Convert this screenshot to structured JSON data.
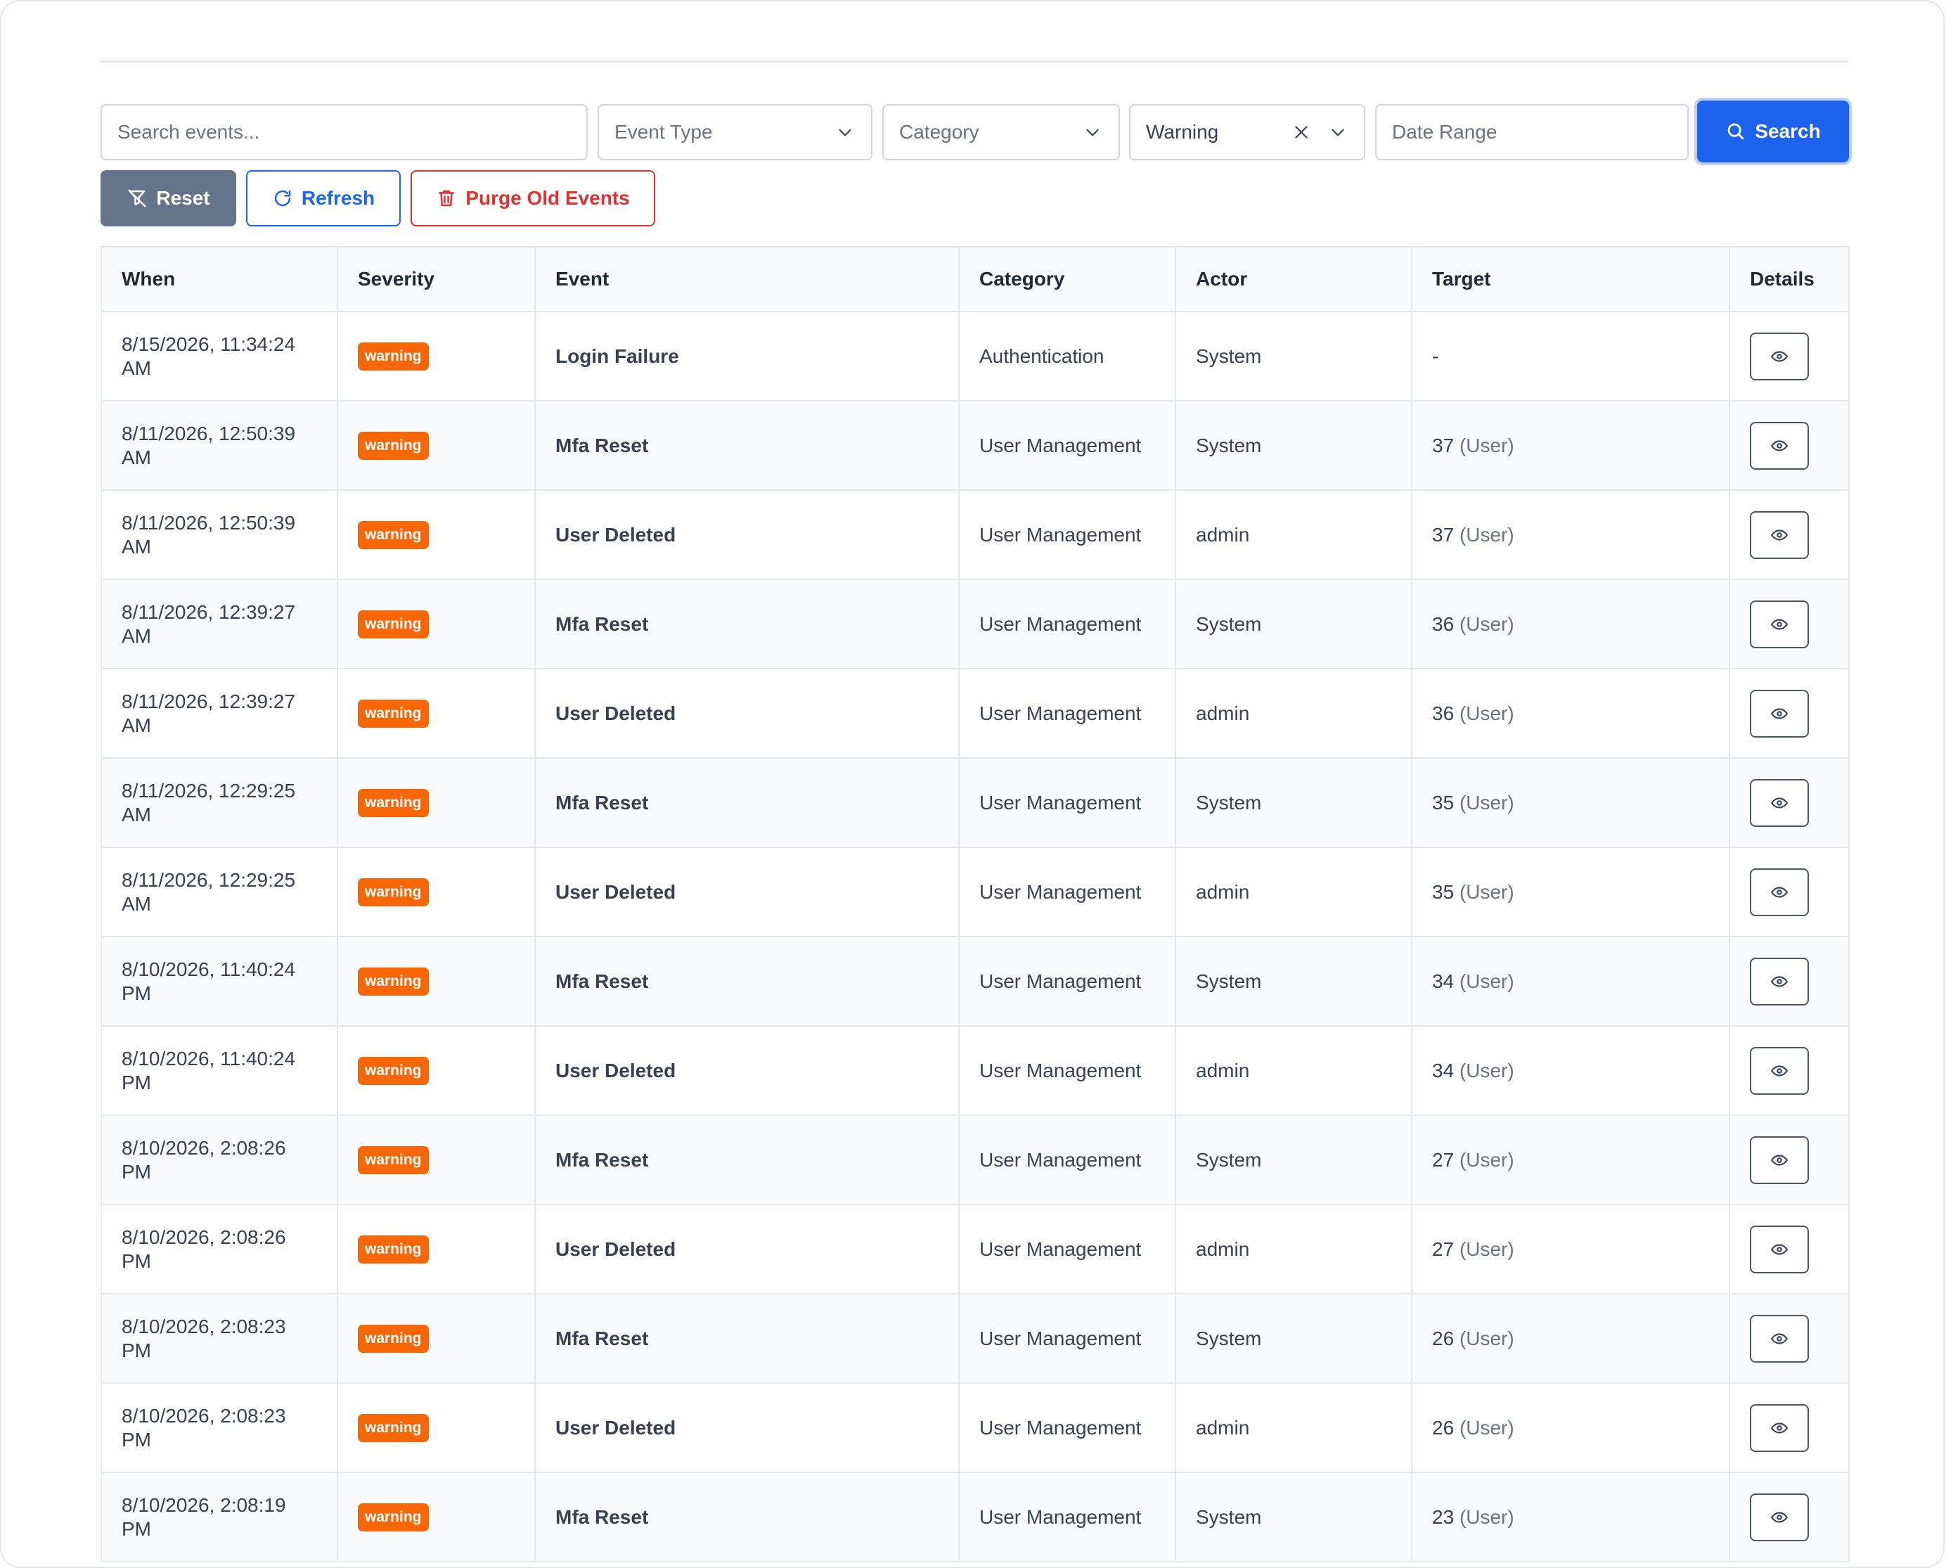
{
  "filters": {
    "search_placeholder": "Search events...",
    "event_type_placeholder": "Event Type",
    "category_placeholder": "Category",
    "severity_selected": "Warning",
    "date_range_placeholder": "Date Range",
    "search_label": "Search"
  },
  "actions": {
    "reset_label": "Reset",
    "refresh_label": "Refresh",
    "purge_label": "Purge Old Events"
  },
  "table": {
    "headers": {
      "when": "When",
      "severity": "Severity",
      "event": "Event",
      "category": "Category",
      "actor": "Actor",
      "target": "Target",
      "details": "Details"
    },
    "rows": [
      {
        "when": "8/15/2026, 11:34:24 AM",
        "severity": "warning",
        "event": "Login Failure",
        "category": "Authentication",
        "actor": "System",
        "target_id": "-",
        "target_type": ""
      },
      {
        "when": "8/11/2026, 12:50:39 AM",
        "severity": "warning",
        "event": "Mfa Reset",
        "category": "User Management",
        "actor": "System",
        "target_id": "37",
        "target_type": "(User)"
      },
      {
        "when": "8/11/2026, 12:50:39 AM",
        "severity": "warning",
        "event": "User Deleted",
        "category": "User Management",
        "actor": "admin",
        "target_id": "37",
        "target_type": "(User)"
      },
      {
        "when": "8/11/2026, 12:39:27 AM",
        "severity": "warning",
        "event": "Mfa Reset",
        "category": "User Management",
        "actor": "System",
        "target_id": "36",
        "target_type": "(User)"
      },
      {
        "when": "8/11/2026, 12:39:27 AM",
        "severity": "warning",
        "event": "User Deleted",
        "category": "User Management",
        "actor": "admin",
        "target_id": "36",
        "target_type": "(User)"
      },
      {
        "when": "8/11/2026, 12:29:25 AM",
        "severity": "warning",
        "event": "Mfa Reset",
        "category": "User Management",
        "actor": "System",
        "target_id": "35",
        "target_type": "(User)"
      },
      {
        "when": "8/11/2026, 12:29:25 AM",
        "severity": "warning",
        "event": "User Deleted",
        "category": "User Management",
        "actor": "admin",
        "target_id": "35",
        "target_type": "(User)"
      },
      {
        "when": "8/10/2026, 11:40:24 PM",
        "severity": "warning",
        "event": "Mfa Reset",
        "category": "User Management",
        "actor": "System",
        "target_id": "34",
        "target_type": "(User)"
      },
      {
        "when": "8/10/2026, 11:40:24 PM",
        "severity": "warning",
        "event": "User Deleted",
        "category": "User Management",
        "actor": "admin",
        "target_id": "34",
        "target_type": "(User)"
      },
      {
        "when": "8/10/2026, 2:08:26 PM",
        "severity": "warning",
        "event": "Mfa Reset",
        "category": "User Management",
        "actor": "System",
        "target_id": "27",
        "target_type": "(User)"
      },
      {
        "when": "8/10/2026, 2:08:26 PM",
        "severity": "warning",
        "event": "User Deleted",
        "category": "User Management",
        "actor": "admin",
        "target_id": "27",
        "target_type": "(User)"
      },
      {
        "when": "8/10/2026, 2:08:23 PM",
        "severity": "warning",
        "event": "Mfa Reset",
        "category": "User Management",
        "actor": "System",
        "target_id": "26",
        "target_type": "(User)"
      },
      {
        "when": "8/10/2026, 2:08:23 PM",
        "severity": "warning",
        "event": "User Deleted",
        "category": "User Management",
        "actor": "admin",
        "target_id": "26",
        "target_type": "(User)"
      },
      {
        "when": "8/10/2026, 2:08:19 PM",
        "severity": "warning",
        "event": "Mfa Reset",
        "category": "User Management",
        "actor": "System",
        "target_id": "23",
        "target_type": "(User)"
      }
    ]
  },
  "icons": {
    "search": "search-icon",
    "chevron": "chevron-down-icon",
    "clear": "close-icon",
    "reset": "filter-off-icon",
    "refresh": "refresh-icon",
    "purge": "trash-icon",
    "details": "eye-icon"
  },
  "colors": {
    "primary": "#1d63ed",
    "danger": "#e03131",
    "warning_badge": "#f76707",
    "reset_button": "#64748b"
  }
}
